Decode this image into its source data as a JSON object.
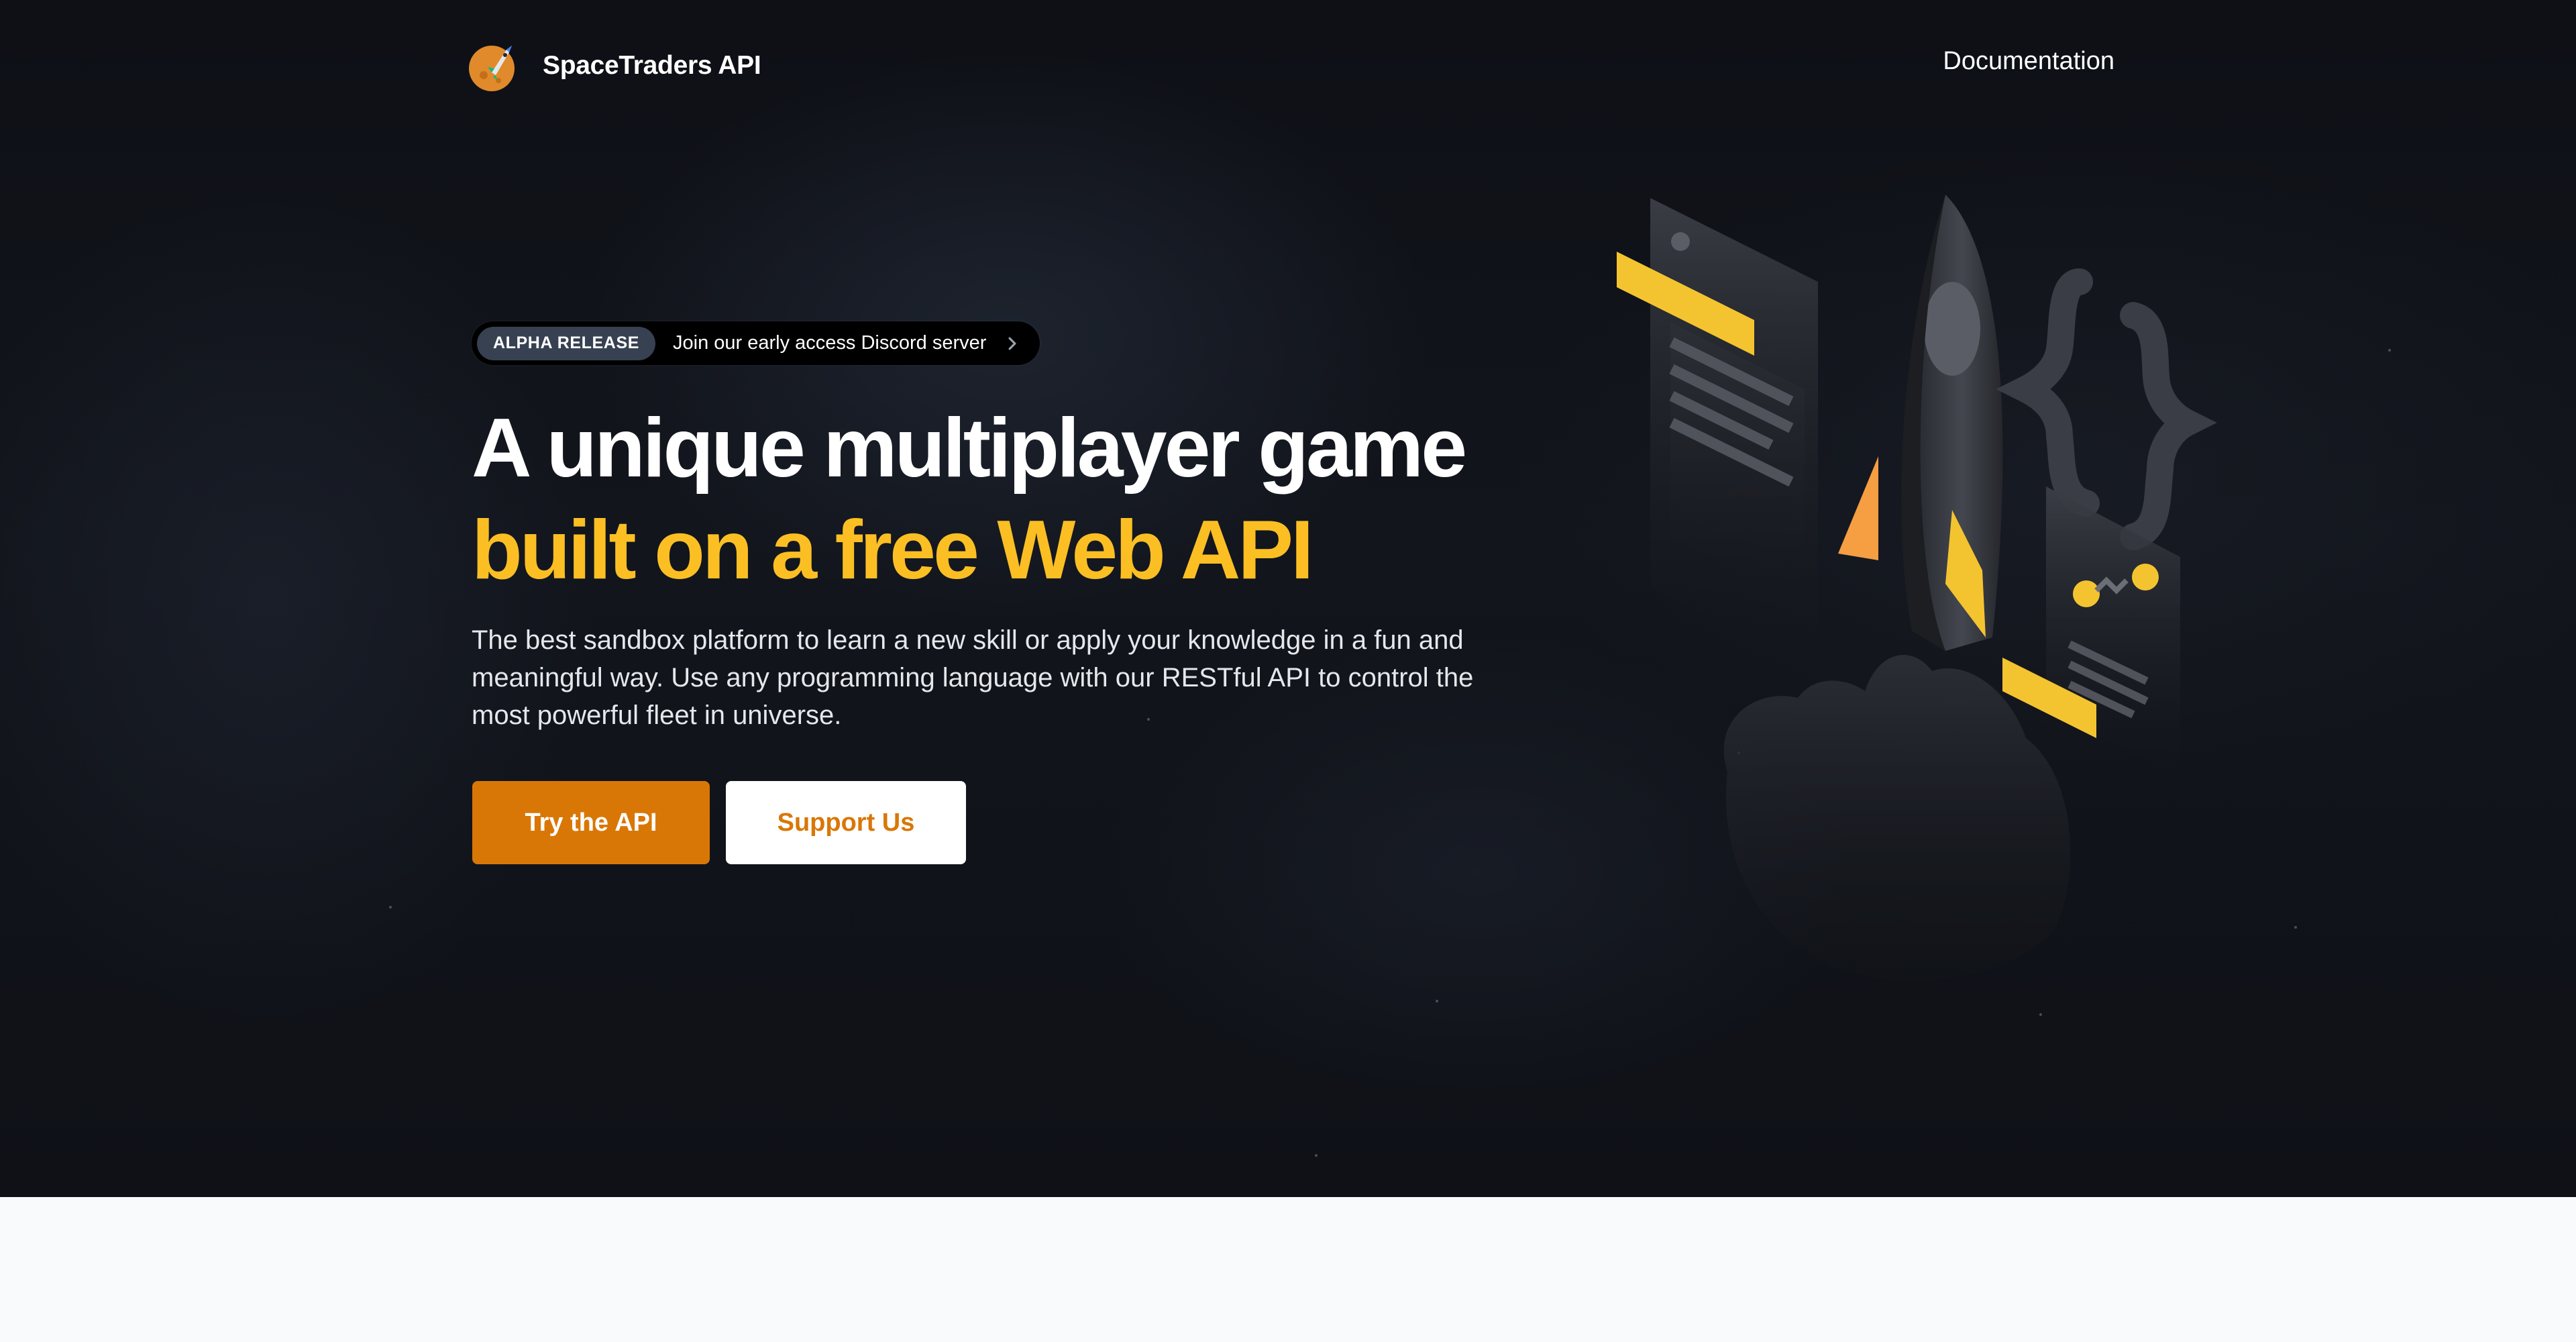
{
  "brand": {
    "name": "SpaceTraders API",
    "logo_icon": "rocket-planet-logo-icon"
  },
  "nav": {
    "documentation": "Documentation"
  },
  "badge": {
    "pill": "ALPHA RELEASE",
    "text": "Join our early access Discord server",
    "icon": "chevron-right-icon"
  },
  "hero": {
    "title_line1": "A unique multiplayer game",
    "title_line2": "built on a free Web API",
    "description": "The best sandbox platform to learn a new skill or apply your knowledge in a fun and meaningful way. Use any programming language with our RESTful API to control the most powerful fleet in universe.",
    "primary_button": "Try the API",
    "secondary_button": "Support Us",
    "illustration_icon": "rocket-code-illustration-icon"
  },
  "colors": {
    "accent": "#d97706",
    "highlight": "#fbbf24",
    "background_dark": "#111318",
    "background_light": "#f8fafc"
  }
}
